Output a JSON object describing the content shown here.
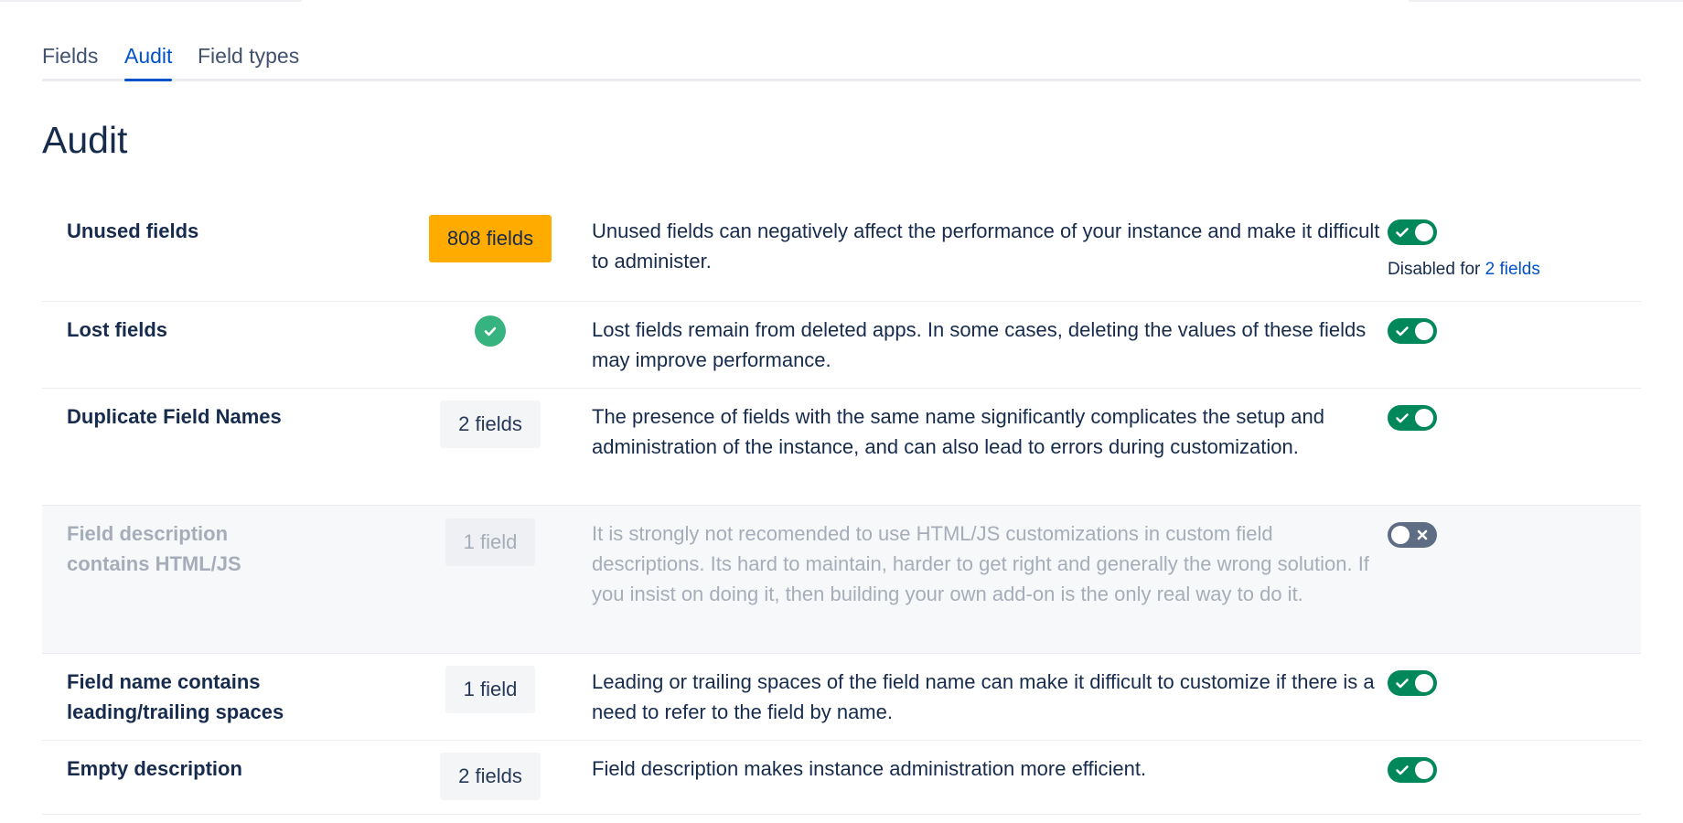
{
  "tabs": [
    {
      "label": "Fields",
      "active": false
    },
    {
      "label": "Audit",
      "active": true
    },
    {
      "label": "Field types",
      "active": false
    }
  ],
  "page_title": "Audit",
  "rows": [
    {
      "name": "Unused fields",
      "count": "808 fields",
      "count_style": "warning",
      "description": "Unused fields can negatively affect the performance of your instance and make it difficult to administer.",
      "enabled": true,
      "note_prefix": "Disabled for",
      "note_link": "2 fields"
    },
    {
      "name": "Lost fields",
      "count_icon": "check-circle-icon",
      "description": "Lost fields remain from deleted apps. In some cases, deleting the values of these fields may improve performance.",
      "enabled": true
    },
    {
      "name": "Duplicate Field Names",
      "count": "2 fields",
      "description": "The presence of fields with the same name significantly complicates the setup and administration of the instance, and can also lead to errors during customization.",
      "enabled": true
    },
    {
      "name": "Field description contains HTML/JS",
      "count": "1 field",
      "description": "It is strongly not recomended to use HTML/JS customizations in custom field descriptions. Its hard to maintain, harder to get right and generally the wrong solution. If you insist on doing it, then building your own add-on is the only real way to do it.",
      "enabled": false
    },
    {
      "name": "Field name contains leading/trailing spaces",
      "count": "1 field",
      "description": "Leading or trailing spaces of the field name can make it difficult to customize if there is a need to refer to the field by name.",
      "enabled": true
    },
    {
      "name": "Empty description",
      "count": "2 fields",
      "description": "Field description makes instance administration more efficient.",
      "enabled": true
    }
  ],
  "colors": {
    "accent": "#0052cc",
    "warning_badge": "#ffab00",
    "toggle_on": "#00875a",
    "toggle_off": "#5e6c84",
    "success": "#36b37e"
  }
}
